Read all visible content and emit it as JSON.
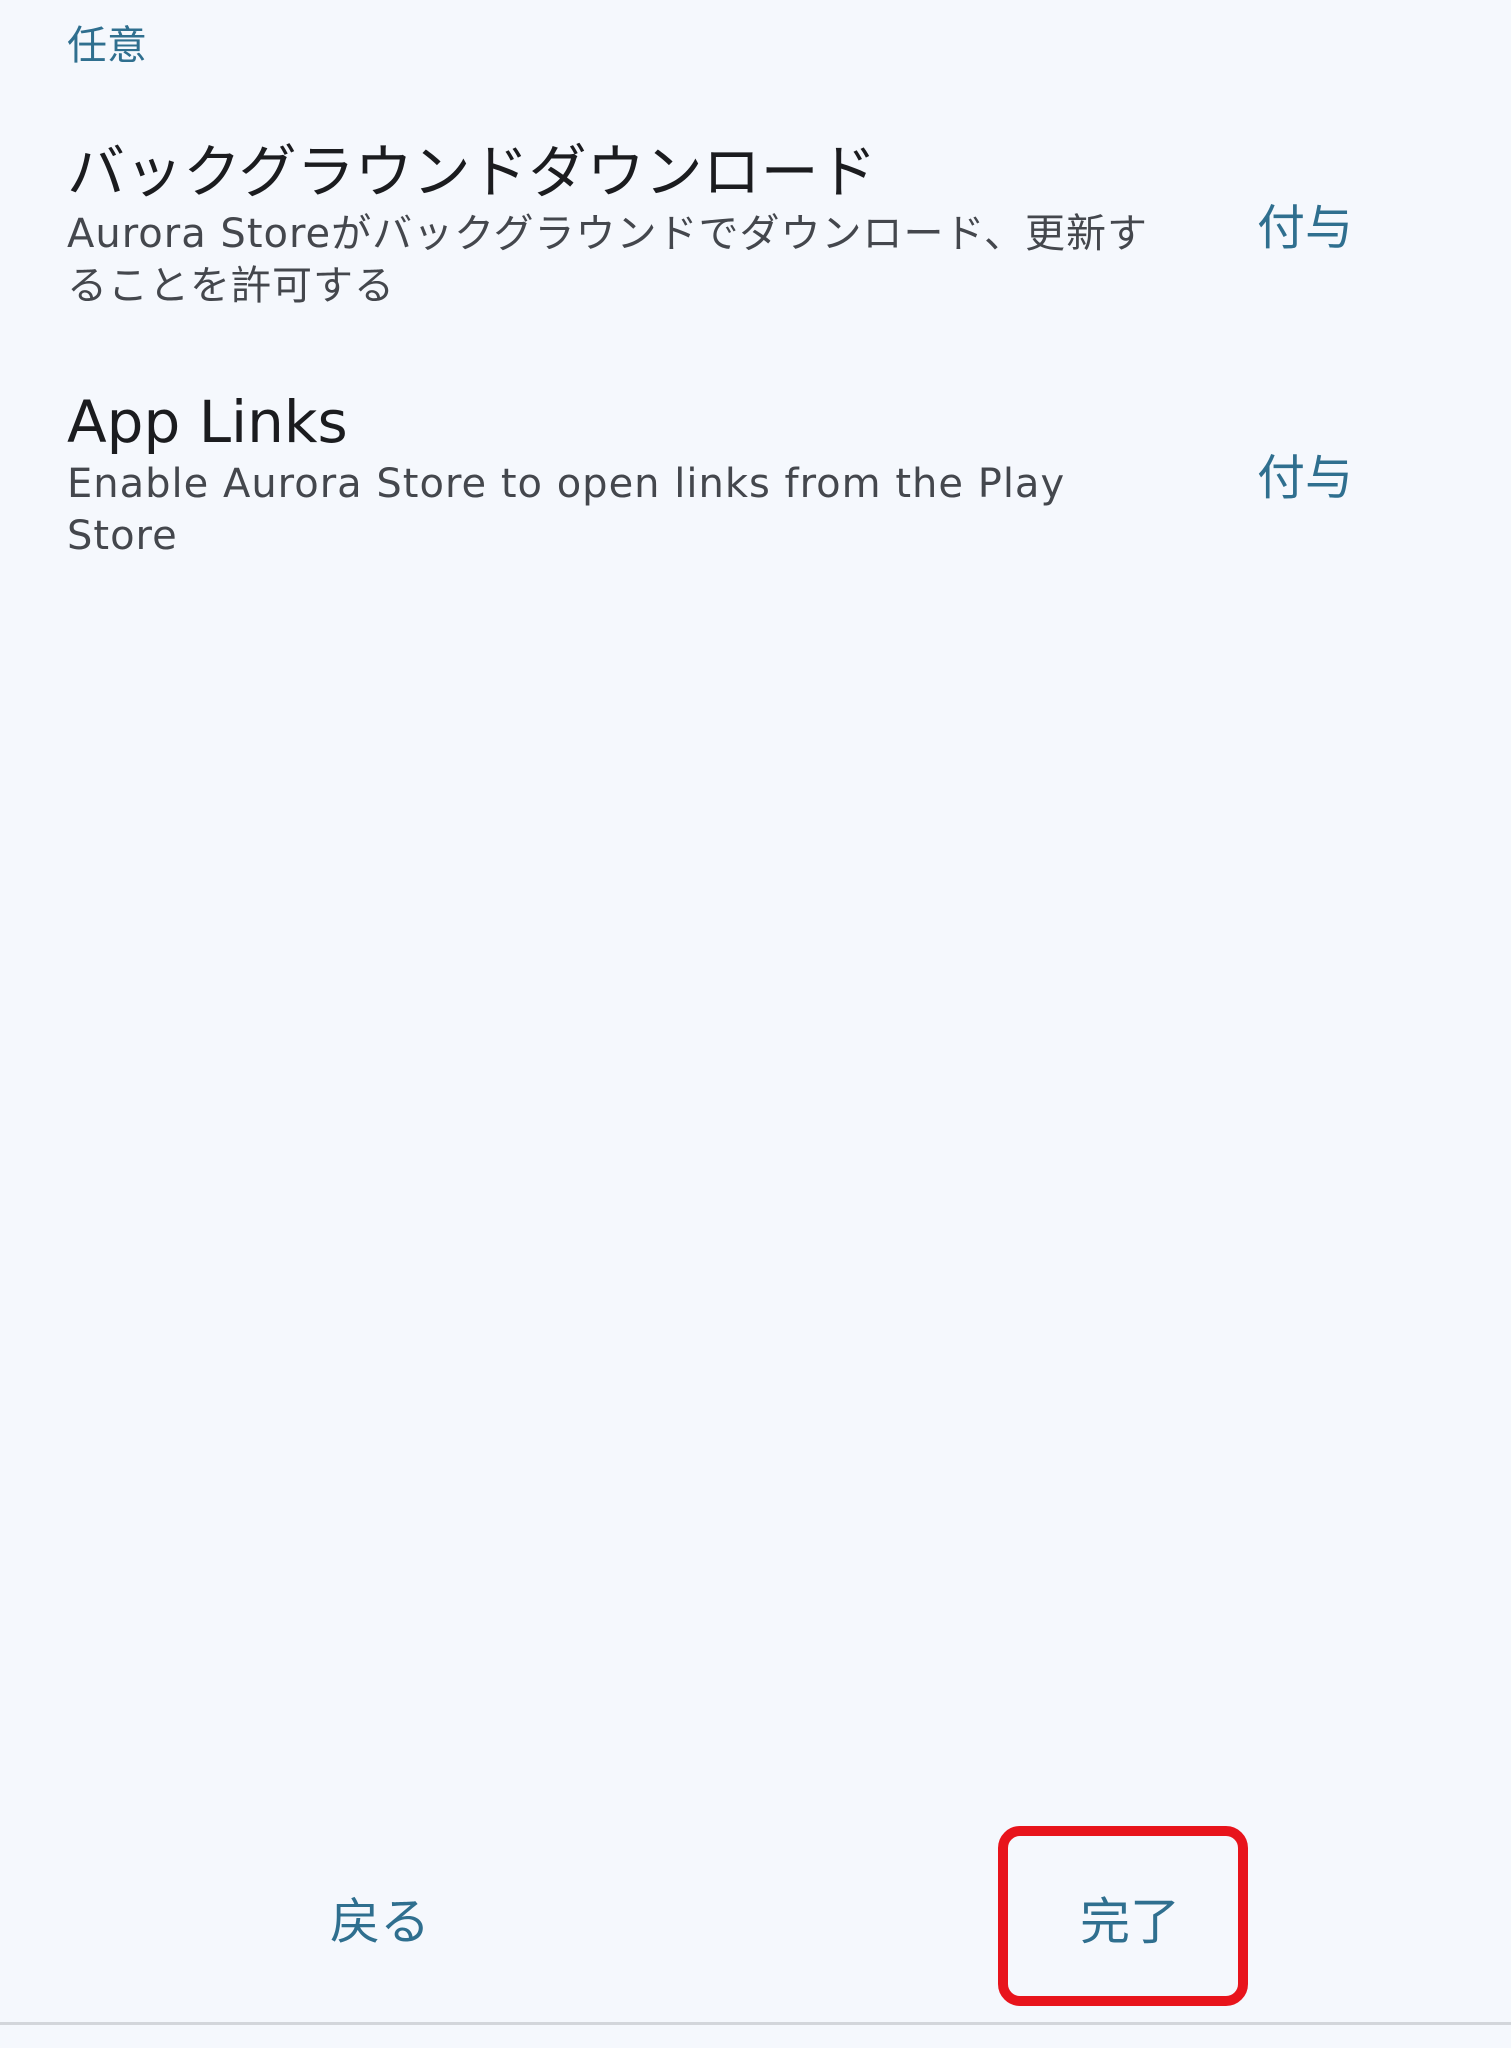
{
  "section": {
    "header": "任意"
  },
  "permissions": [
    {
      "title": "バックグラウンドダウンロード",
      "description": "Aurora Storeがバックグラウンドでダウンロード、更新することを許可する",
      "action_label": "付与"
    },
    {
      "title": "App Links",
      "description": "Enable Aurora Store to open links from the Play Store",
      "action_label": "付与"
    }
  ],
  "footer": {
    "back_label": "戻る",
    "done_label": "完了"
  },
  "annotation": {
    "highlight_color": "#e8141c"
  },
  "colors": {
    "accent": "#2f6f8f",
    "background": "#f5f8fd",
    "title_text": "#1b1c1f",
    "body_text": "#44474d"
  }
}
